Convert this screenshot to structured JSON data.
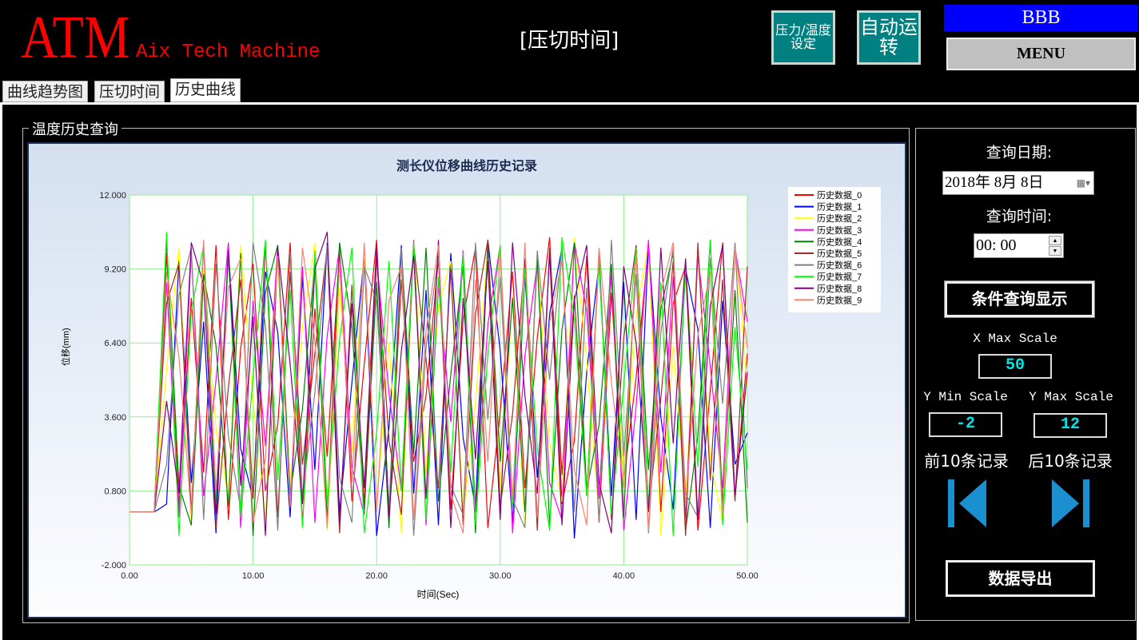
{
  "header": {
    "logo": "ATM",
    "logo_sub": "Aix Tech Machine",
    "screen_title": "[压切时间]",
    "btn_settings": "压力/温度设定",
    "btn_auto": "自动运转",
    "user": "BBB",
    "menu": "MENU"
  },
  "tabs": [
    {
      "label": "曲线趋势图",
      "active": false
    },
    {
      "label": "压切时间",
      "active": false
    },
    {
      "label": "历史曲线",
      "active": true
    }
  ],
  "group_title": "温度历史查询",
  "query": {
    "date_label": "查询日期:",
    "date_value": "2018年  8月  8日",
    "time_label": "查询时间:",
    "time_value": "00: 00",
    "query_button": "条件查询显示",
    "x_max_label": "X Max Scale",
    "x_max": "50",
    "y_min_label": "Y Min Scale",
    "y_min": "-2",
    "y_max_label": "Y Max Scale",
    "y_max": "12",
    "prev_label": "前10条记录",
    "next_label": "后10条记录",
    "export_button": "数据导出"
  },
  "chart_data": {
    "type": "line",
    "title": "测长仪位移曲线历史记录",
    "xlabel": "时间(Sec)",
    "ylabel": "位移(mm)",
    "xlim": [
      0,
      50
    ],
    "ylim": [
      -2,
      12
    ],
    "xticks": [
      "0.00",
      "10.00",
      "20.00",
      "30.00",
      "40.00",
      "50.00"
    ],
    "yticks": [
      "-2.000",
      "0.800",
      "3.600",
      "6.400",
      "9.200",
      "12.000"
    ],
    "grid": true,
    "legend": "right",
    "x": [
      0,
      2,
      3,
      4,
      5,
      6,
      7,
      8,
      9,
      10,
      11,
      12,
      13,
      14,
      15,
      16,
      17,
      18,
      19,
      20,
      21,
      22,
      23,
      24,
      25,
      26,
      27,
      28,
      29,
      30,
      31,
      32,
      33,
      34,
      35,
      36,
      37,
      38,
      39,
      40,
      41,
      42,
      43,
      44,
      45,
      46,
      47,
      48,
      49,
      50
    ],
    "series": [
      {
        "name": "历史数据_0",
        "color": "#ff0000",
        "values": [
          0,
          0,
          9.8,
          0.2,
          8.1,
          1.5,
          10.1,
          -0.3,
          6.2,
          9.4,
          0.8,
          3.3,
          10.2,
          -0.5,
          7.7,
          2.1,
          9.9,
          0.4,
          5.6,
          10.3,
          -0.2,
          8.8,
          1.9,
          4.4,
          9.6,
          0.1,
          7.3,
          10.0,
          -0.6,
          3.8,
          9.1,
          0.9,
          6.6,
          10.4,
          0.3,
          2.7,
          9.7,
          -0.4,
          8.3,
          1.2,
          5.1,
          10.1,
          0.0,
          7.9,
          9.3,
          -0.7,
          4.6,
          10.2,
          0.5,
          6.0
        ]
      },
      {
        "name": "历史数据_1",
        "color": "#0000ff",
        "values": [
          0,
          0,
          0.3,
          9.5,
          1.1,
          7.2,
          -0.8,
          10.0,
          2.4,
          0.5,
          9.1,
          6.8,
          -0.2,
          8.9,
          1.6,
          10.2,
          0.0,
          4.9,
          9.7,
          -0.9,
          3.2,
          10.1,
          0.7,
          8.4,
          -0.5,
          9.8,
          2.8,
          0.2,
          10.3,
          6.1,
          -0.4,
          9.0,
          1.3,
          7.5,
          10.0,
          -1.0,
          5.3,
          9.4,
          0.6,
          8.7,
          -0.3,
          10.1,
          3.6,
          0.1,
          9.2,
          6.9,
          -0.6,
          8.0,
          1.8,
          3.0
        ]
      },
      {
        "name": "历史数据_2",
        "color": "#ffff00",
        "values": [
          0,
          0,
          5.4,
          10.0,
          -0.4,
          9.2,
          3.1,
          0.6,
          10.1,
          4.2,
          -0.3,
          9.6,
          0.9,
          7.0,
          10.2,
          -0.7,
          8.5,
          2.3,
          9.9,
          0.1,
          6.4,
          -0.8,
          10.3,
          1.4,
          7.8,
          9.5,
          -0.2,
          4.1,
          10.0,
          0.8,
          8.2,
          -0.6,
          9.7,
          2.6,
          0.4,
          10.4,
          5.7,
          -0.1,
          9.1,
          1.0,
          7.4,
          10.2,
          -0.9,
          6.3,
          0.3,
          9.8,
          2.0,
          -0.4,
          10.1,
          4.8
        ]
      },
      {
        "name": "历史数据_3",
        "color": "#ff00ff",
        "values": [
          0,
          0,
          8.7,
          -0.2,
          9.9,
          0.6,
          5.0,
          10.2,
          -0.6,
          8.0,
          2.5,
          10.1,
          0.2,
          9.3,
          -0.4,
          6.7,
          10.0,
          1.7,
          -0.1,
          9.6,
          4.5,
          0.8,
          10.3,
          -0.5,
          8.6,
          3.4,
          9.9,
          0.0,
          7.1,
          10.1,
          -0.8,
          5.9,
          9.4,
          1.1,
          -0.3,
          10.2,
          7.6,
          0.5,
          9.0,
          -0.7,
          4.0,
          10.3,
          1.5,
          8.9,
          -0.2,
          9.7,
          5.5,
          0.9,
          10.0,
          7.2
        ]
      },
      {
        "name": "历史数据_4",
        "color": "#008000",
        "values": [
          0,
          0,
          10.3,
          1.0,
          -0.5,
          9.0,
          6.3,
          0.2,
          9.8,
          -0.9,
          8.3,
          10.1,
          0.7,
          3.9,
          9.5,
          -0.3,
          10.2,
          7.0,
          0.1,
          8.7,
          -0.6,
          9.9,
          2.2,
          10.0,
          0.4,
          5.2,
          9.3,
          -0.8,
          10.1,
          1.9,
          8.1,
          0.0,
          9.6,
          -0.5,
          6.9,
          10.2,
          0.8,
          3.3,
          9.4,
          -0.2,
          10.0,
          1.6,
          7.7,
          9.8,
          -0.7,
          2.9,
          10.3,
          0.3,
          8.4,
          -0.4
        ]
      },
      {
        "name": "历史数据_5",
        "color": "#a52a2a",
        "values": [
          0,
          0,
          7.9,
          9.4,
          0.0,
          10.1,
          -0.6,
          4.7,
          8.8,
          0.5,
          10.2,
          -0.2,
          9.1,
          1.8,
          6.0,
          10.0,
          -0.8,
          8.6,
          0.3,
          9.7,
          2.7,
          -0.1,
          10.1,
          5.8,
          0.9,
          9.2,
          -0.5,
          7.5,
          10.3,
          0.2,
          3.7,
          9.6,
          -0.7,
          10.0,
          1.4,
          8.2,
          0.6,
          9.9,
          -0.3,
          6.6,
          10.1,
          0.1,
          4.3,
          9.5,
          -0.9,
          10.2,
          1.2,
          8.8,
          0.4,
          9.3
        ]
      },
      {
        "name": "历史数据_6",
        "color": "#808080",
        "values": [
          0,
          0,
          1.8,
          8.2,
          10.0,
          -0.3,
          9.4,
          2.9,
          0.1,
          10.2,
          7.1,
          -0.7,
          9.8,
          0.6,
          4.5,
          10.1,
          1.3,
          -0.4,
          9.3,
          8.0,
          0.2,
          10.0,
          -0.9,
          6.2,
          9.7,
          1.0,
          -0.1,
          10.2,
          3.5,
          8.9,
          0.5,
          -0.6,
          9.9,
          5.0,
          10.1,
          0.0,
          8.5,
          -0.4,
          10.3,
          2.1,
          9.0,
          -0.8,
          6.8,
          10.0,
          0.7,
          -0.2,
          9.6,
          4.1,
          10.2,
          0.9
        ]
      },
      {
        "name": "历史数据_7",
        "color": "#00ff00",
        "values": [
          0,
          0,
          10.6,
          -0.9,
          7.6,
          10.1,
          0.4,
          9.7,
          -0.2,
          5.1,
          10.3,
          1.2,
          8.4,
          -0.6,
          9.9,
          0.3,
          6.5,
          10.0,
          -0.8,
          3.0,
          9.5,
          0.8,
          10.2,
          -0.3,
          8.9,
          1.5,
          9.8,
          -0.5,
          6.0,
          10.1,
          0.1,
          9.2,
          2.4,
          -0.7,
          10.4,
          7.3,
          0.6,
          9.6,
          -0.1,
          4.8,
          10.0,
          0.2,
          8.7,
          -0.9,
          9.4,
          1.7,
          10.3,
          -0.5,
          7.0,
          1.6
        ]
      },
      {
        "name": "历史数据_8",
        "color": "#800080",
        "values": [
          0,
          0,
          4.2,
          0.7,
          10.2,
          8.6,
          -0.1,
          9.9,
          1.0,
          7.4,
          -0.9,
          10.0,
          5.6,
          0.3,
          9.2,
          10.6,
          -0.4,
          7.9,
          0.9,
          10.1,
          -0.2,
          6.1,
          9.7,
          0.5,
          10.3,
          -0.6,
          8.1,
          2.0,
          9.5,
          -0.3,
          10.2,
          4.4,
          0.7,
          9.8,
          -0.5,
          8.0,
          10.1,
          1.1,
          -0.8,
          9.3,
          6.4,
          0.0,
          10.0,
          2.6,
          9.6,
          -0.3,
          7.8,
          10.1,
          0.6,
          5.3
        ]
      },
      {
        "name": "历史数据_9",
        "color": "#fa8072",
        "values": [
          0,
          0,
          9.1,
          5.9,
          -0.1,
          10.3,
          0.8,
          8.5,
          9.6,
          -0.4,
          2.0,
          9.7,
          0.2,
          10.0,
          6.5,
          -0.6,
          9.4,
          1.1,
          10.2,
          0.0,
          8.0,
          9.3,
          -0.3,
          6.9,
          10.1,
          0.7,
          -0.8,
          8.8,
          1.9,
          9.9,
          0.4,
          10.2,
          -0.2,
          7.2,
          9.5,
          1.6,
          -0.5,
          10.0,
          4.9,
          0.9,
          9.8,
          -0.7,
          8.3,
          10.2,
          0.2,
          6.7,
          9.1,
          -0.1,
          10.0,
          6.2
        ]
      }
    ]
  }
}
